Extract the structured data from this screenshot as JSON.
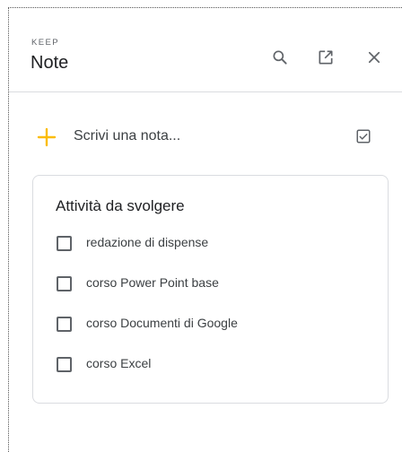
{
  "header": {
    "app_label": "KEEP",
    "title": "Note"
  },
  "compose": {
    "placeholder": "Scrivi una nota..."
  },
  "note": {
    "title": "Attività da svolgere",
    "items": [
      {
        "label": "redazione di dispense",
        "checked": false
      },
      {
        "label": "corso Power Point base",
        "checked": false
      },
      {
        "label": "corso Documenti di Google",
        "checked": false
      },
      {
        "label": "corso Excel",
        "checked": false
      }
    ]
  },
  "colors": {
    "accent_plus": "#fbbc04",
    "icon_gray": "#5f6368",
    "border": "#dadce0"
  }
}
